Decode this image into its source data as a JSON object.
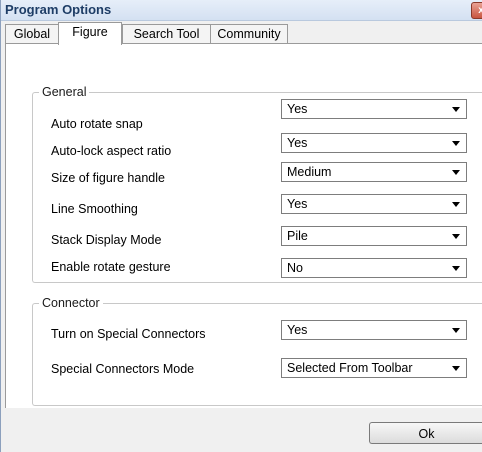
{
  "window": {
    "title": "Program Options",
    "close_label": "x"
  },
  "tabs": [
    {
      "label": "Global",
      "active": false
    },
    {
      "label": "Figure",
      "active": true
    },
    {
      "label": "Search Tool",
      "active": false
    },
    {
      "label": "Community",
      "active": false
    }
  ],
  "general": {
    "legend": "General",
    "rows": [
      {
        "label": "Auto rotate snap",
        "value": "Yes"
      },
      {
        "label": "Auto-lock aspect ratio",
        "value": "Yes"
      },
      {
        "label": "Size of figure handle",
        "value": "Medium"
      },
      {
        "label": "Line Smoothing",
        "value": "Yes"
      },
      {
        "label": "Stack Display Mode",
        "value": "Pile"
      },
      {
        "label": "Enable rotate gesture",
        "value": "No"
      }
    ]
  },
  "connector": {
    "legend": "Connector",
    "rows": [
      {
        "label": "Turn on Special Connectors",
        "value": "Yes"
      },
      {
        "label": "Special Connectors Mode",
        "value": "Selected From Toolbar"
      }
    ]
  },
  "footer": {
    "ok_label": "Ok"
  }
}
